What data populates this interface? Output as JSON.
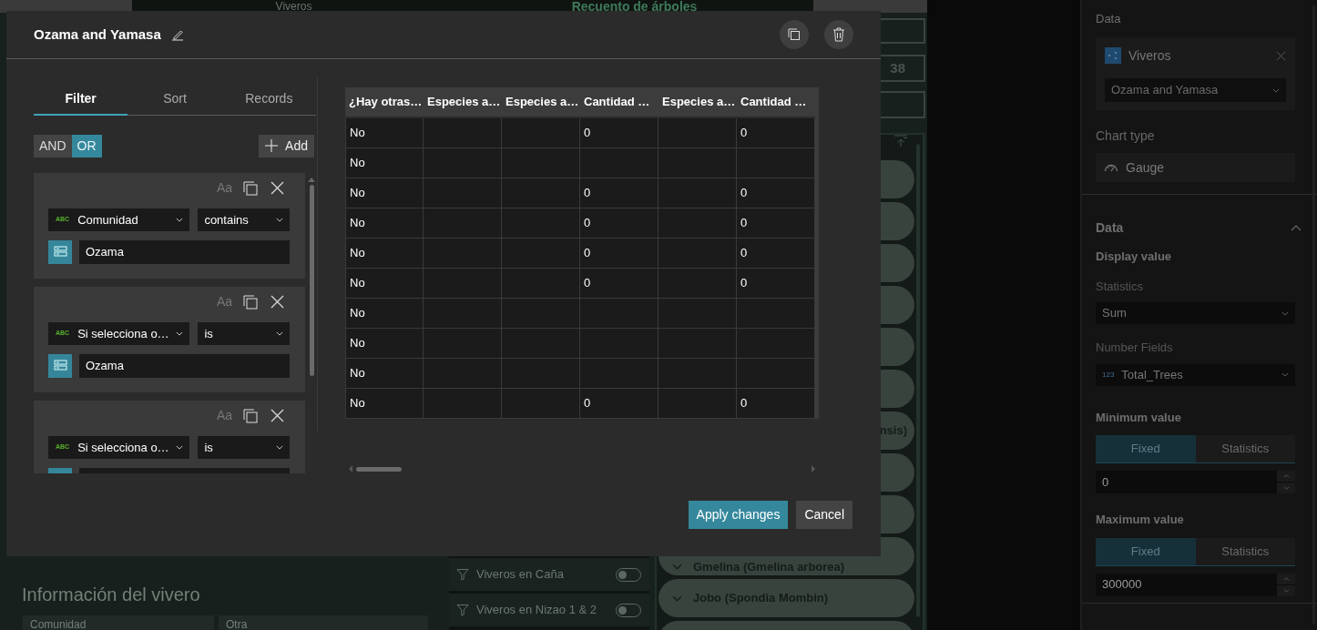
{
  "background": {
    "header_tabs": [
      {
        "label": "Viveros",
        "selected": false
      },
      {
        "label": "Recuento de árboles",
        "selected": true
      }
    ],
    "stat_value": "38",
    "species": [
      {
        "kind": "blank"
      },
      {
        "kind": "blank"
      },
      {
        "kind": "blank"
      },
      {
        "kind": "blank"
      },
      {
        "kind": "blank"
      },
      {
        "kind": "blank"
      },
      {
        "kind": "cut",
        "label": "nsis)"
      },
      {
        "kind": "blank"
      },
      {
        "kind": "blank"
      },
      {
        "kind": "peek",
        "label": "Gmelina (Gmelina arborea)"
      },
      {
        "kind": "expandable",
        "label": "Jobo (Spondia Mombin)"
      },
      {
        "kind": "blank"
      }
    ],
    "filters": [
      {
        "label": "Viveros en Caña",
        "on": false
      },
      {
        "label": "Viveros en Nizao 1 & 2",
        "on": false
      }
    ],
    "info": {
      "title": "Información del vivero",
      "fields": [
        "Comunidad",
        "Otra"
      ]
    }
  },
  "modal": {
    "title": "Ozama and Yamasa",
    "tabs": [
      {
        "label": "Filter",
        "selected": true
      },
      {
        "label": "Sort",
        "selected": false
      },
      {
        "label": "Records",
        "selected": false
      }
    ],
    "logic": [
      {
        "label": "AND",
        "selected": false
      },
      {
        "label": "OR",
        "selected": true
      }
    ],
    "add_label": "Add",
    "filters": [
      {
        "case_label": "Aa",
        "case_sensitive": false,
        "field_type": "ABC",
        "field": "Comunidad",
        "operator": "contains",
        "value": "Ozama"
      },
      {
        "case_label": "Aa",
        "case_sensitive": false,
        "field_type": "ABC",
        "field": "Si selecciona o…",
        "operator": "is",
        "value": "Ozama"
      },
      {
        "case_label": "Aa",
        "case_sensitive": false,
        "field_type": "ABC",
        "field": "Si selecciona o…",
        "operator": "is"
      }
    ],
    "table": {
      "columns": [
        "¿Hay otras…",
        "Especies a…",
        "Especies a…",
        "Cantidad …",
        "Especies a…",
        "Cantidad …"
      ],
      "rows": [
        {
          "col_1": "No",
          "col_4": "0",
          "col_6": "0"
        },
        {
          "col_1": "No"
        },
        {
          "col_1": "No",
          "col_4": "0",
          "col_6": "0"
        },
        {
          "col_1": "No",
          "col_4": "0",
          "col_6": "0"
        },
        {
          "col_1": "No",
          "col_4": "0",
          "col_6": "0"
        },
        {
          "col_1": "No",
          "col_4": "0",
          "col_6": "0"
        },
        {
          "col_1": "No"
        },
        {
          "col_1": "No"
        },
        {
          "col_1": "No"
        },
        {
          "col_1": "No",
          "col_4": "0",
          "col_6": "0"
        }
      ]
    },
    "buttons": [
      {
        "label": "Apply changes",
        "kind": "primary"
      },
      {
        "label": "Cancel",
        "kind": "secondary"
      }
    ]
  },
  "side_panel": {
    "data_label": "Data",
    "layer": {
      "name": "Viveros",
      "view": "Ozama and Yamasa"
    },
    "chart_type_label": "Chart type",
    "chart_type": "Gauge",
    "section": {
      "title": "Data",
      "expanded": true,
      "display_value": "Display value",
      "statistics_label": "Statistics",
      "statistics": "Sum",
      "number_fields_label": "Number Fields",
      "field_type": "123",
      "field": "Total_Trees",
      "ranges": [
        {
          "label": "Minimum value",
          "modes": [
            {
              "label": "Fixed",
              "selected": true
            },
            {
              "label": "Statistics",
              "selected": false
            }
          ],
          "value": "0"
        },
        {
          "label": "Maximum value",
          "modes": [
            {
              "label": "Fixed",
              "selected": true
            },
            {
              "label": "Statistics",
              "selected": false
            }
          ],
          "value": "300000"
        }
      ]
    }
  }
}
